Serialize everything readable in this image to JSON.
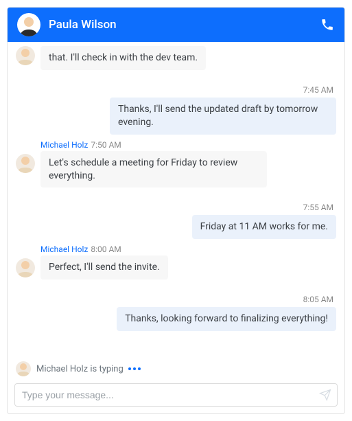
{
  "header": {
    "contact_name": "Paula Wilson"
  },
  "messages": [
    {
      "side": "left",
      "sender": "Michael Holz",
      "time": "",
      "showHeader": false,
      "text": "that. I'll check in with the dev team."
    },
    {
      "side": "right",
      "time": "7:45 AM",
      "text": "Thanks, I'll send the updated draft by tomorrow evening."
    },
    {
      "side": "left",
      "sender": "Michael Holz",
      "time": "7:50 AM",
      "showHeader": true,
      "text": "Let's schedule a meeting for Friday to review everything."
    },
    {
      "side": "right",
      "time": "7:55 AM",
      "text": "Friday at 11 AM works for me."
    },
    {
      "side": "left",
      "sender": "Michael Holz",
      "time": "8:00 AM",
      "showHeader": true,
      "text": "Perfect, I'll send the invite."
    },
    {
      "side": "right",
      "time": "8:05 AM",
      "text": "Thanks, looking forward to finalizing everything!"
    }
  ],
  "typing": {
    "text": "Michael Holz is typing"
  },
  "input": {
    "placeholder": "Type your message..."
  },
  "colors": {
    "accent": "#0d6efd",
    "incoming_bg": "#f7f7f7",
    "outgoing_bg": "#eaf1fb"
  }
}
